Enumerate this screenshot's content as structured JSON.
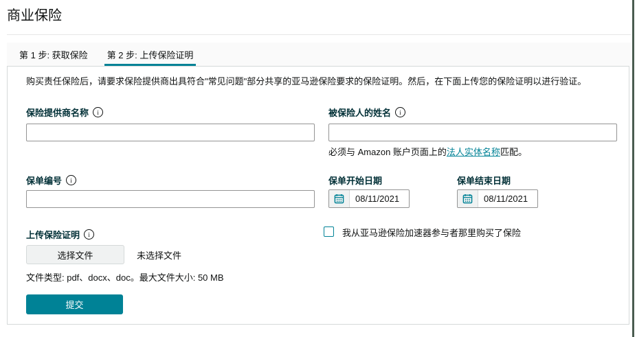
{
  "page": {
    "title": "商业保险"
  },
  "icons": {
    "info": "i"
  },
  "tabs": {
    "step1": "第 1 步: 获取保险",
    "step2": "第 2 步: 上传保险证明"
  },
  "form": {
    "description": "购买责任保险后，请要求保险提供商出具符合\"常见问题\"部分共享的亚马逊保险要求的保险证明。然后，在下面上传您的保险证明以进行验证。",
    "provider": {
      "label": "保险提供商名称",
      "value": ""
    },
    "insured": {
      "label": "被保险人的姓名",
      "value": "",
      "helper_prefix": "必须与 Amazon 账户页面上的",
      "helper_link": "法人实体名称",
      "helper_suffix": "匹配。"
    },
    "policy_number": {
      "label": "保单编号",
      "value": ""
    },
    "start_date": {
      "label": "保单开始日期",
      "value": "08/11/2021"
    },
    "end_date": {
      "label": "保单结束日期",
      "value": "08/11/2021"
    },
    "upload": {
      "label": "上传保险证明",
      "button": "选择文件",
      "status": "未选择文件",
      "hint": "文件类型: pdf、docx、doc。最大文件大小: 50 MB"
    },
    "accelerator": {
      "label": "我从亚马逊保险加速器参与者那里购买了保险",
      "checked": false
    },
    "submit": "提交"
  },
  "colors": {
    "accent": "#008296",
    "label_text": "#002f36",
    "panel_border": "#d5d9d9",
    "edge_line": "#4a5c50"
  }
}
